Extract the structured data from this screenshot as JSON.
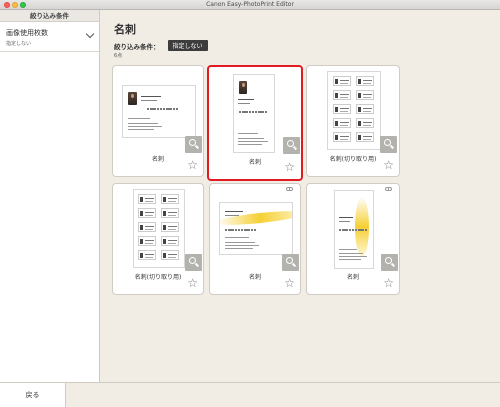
{
  "window": {
    "title": "Canon Easy-PhotoPrint Editor"
  },
  "sidebar": {
    "header": "絞り込み条件",
    "filter": {
      "label": "画像使用枚数",
      "value": "指定しない"
    }
  },
  "main": {
    "title": "名刺",
    "condition_label": "絞り込み条件：",
    "condition_value": "指定しない",
    "count": "6点"
  },
  "cards": [
    {
      "label": "名刺",
      "style": "photo-landscape",
      "selected": false,
      "download_icon": false
    },
    {
      "label": "名刺",
      "style": "photo-portrait",
      "selected": true,
      "download_icon": false
    },
    {
      "label": "名刺(切り取り用)",
      "style": "sheet-landscape",
      "selected": false,
      "download_icon": false
    },
    {
      "label": "名刺(切り取り用)",
      "style": "sheet-portrait",
      "selected": false,
      "download_icon": false
    },
    {
      "label": "名刺",
      "style": "yellow-landscape",
      "selected": false,
      "download_icon": true
    },
    {
      "label": "名刺",
      "style": "yellow-portrait",
      "selected": false,
      "download_icon": true
    }
  ],
  "footer": {
    "back_label": "戻る"
  },
  "colors": {
    "selection": "#e11b22",
    "accent_yellow": "#f5cd28",
    "badge": "#3c3c3c"
  }
}
